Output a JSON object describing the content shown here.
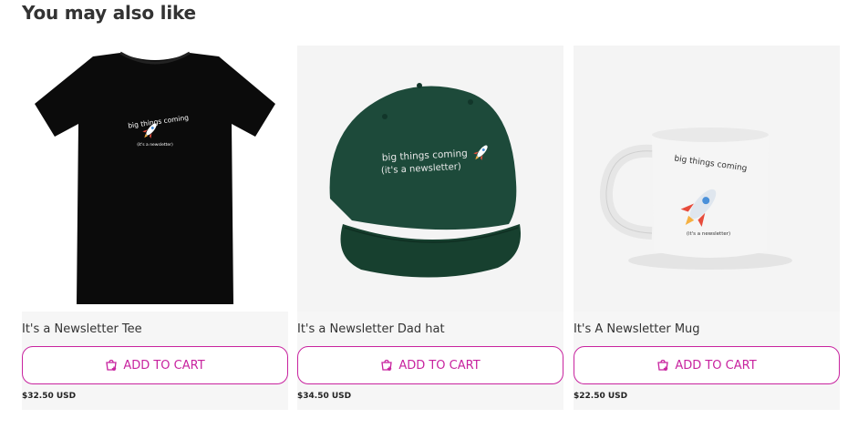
{
  "section": {
    "title": "You may also like"
  },
  "colors": {
    "accent": "#c8239f",
    "card_bg": "#f6f6f6"
  },
  "products": [
    {
      "name": "It's a Newsletter Tee",
      "button_label": "ADD TO CART",
      "button_icon": "cart-plus-icon",
      "price": "$32.50 USD",
      "image": {
        "kind": "t-shirt",
        "color": "#0b0b0b",
        "print_line1": "big things coming",
        "print_line2": "(it's a newsletter)"
      }
    },
    {
      "name": "It's a Newsletter Dad hat",
      "button_label": "ADD TO CART",
      "button_icon": "cart-plus-icon",
      "price": "$34.50 USD",
      "image": {
        "kind": "dad-hat",
        "color": "#1d4a3a",
        "print_line1": "big things coming",
        "print_line2": "(it's a newsletter)"
      }
    },
    {
      "name": "It's A Newsletter Mug",
      "button_label": "ADD TO CART",
      "button_icon": "cart-plus-icon",
      "price": "$22.50 USD",
      "image": {
        "kind": "mug",
        "color": "#f2f2f2",
        "print_line1": "big things coming",
        "print_line2": "(it's a newsletter)"
      }
    }
  ]
}
